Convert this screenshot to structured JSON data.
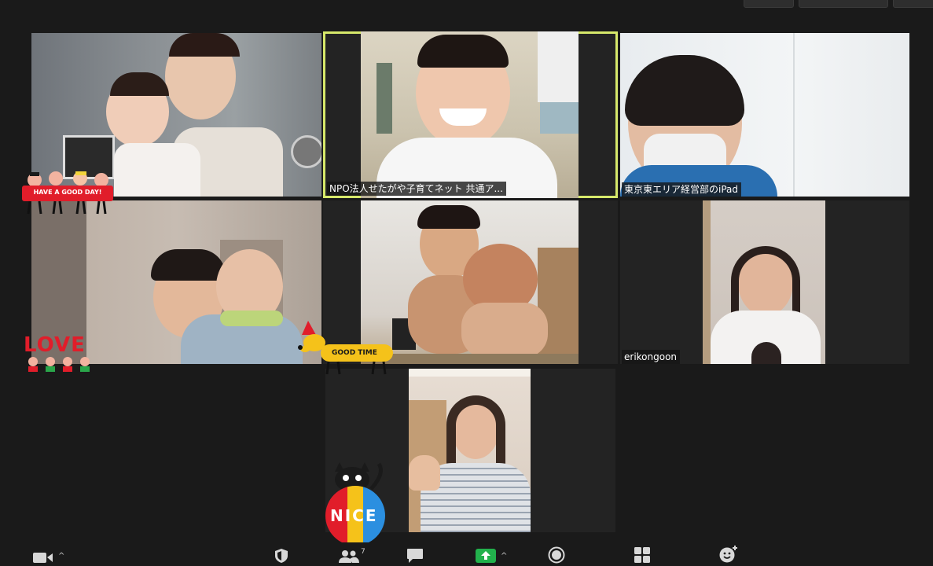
{
  "participants": [
    {
      "id": "p1",
      "name": ""
    },
    {
      "id": "p2",
      "name": "NPO法人せたがや子育てネット 共通ア...",
      "active": true
    },
    {
      "id": "p3",
      "name": "東京東エリア経営部のiPad"
    },
    {
      "id": "p4",
      "name": ""
    },
    {
      "id": "p5",
      "name": ""
    },
    {
      "id": "p6",
      "name": "erikongoon"
    },
    {
      "id": "p7",
      "name": ""
    }
  ],
  "stickers": {
    "have_a_good_day": "HAVE A GOOD DAY!",
    "love": "LOVE",
    "good_time": "GOOD TIME",
    "nice": "NICE"
  },
  "toolbar": {
    "participants_count": "7",
    "icons": [
      "video-camera-icon",
      "security-shield-icon",
      "participants-icon",
      "chat-icon",
      "share-screen-icon",
      "record-icon",
      "breakout-rooms-icon",
      "reactions-icon"
    ]
  },
  "colors": {
    "active_speaker_border": "#d6e86a",
    "share_green": "#22b14c",
    "background": "#1a1a1a"
  }
}
